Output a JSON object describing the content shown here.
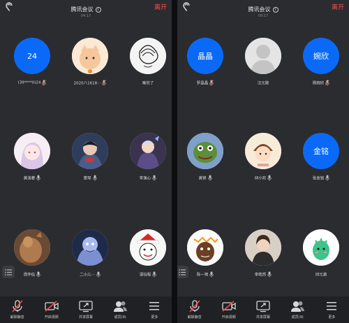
{
  "left": {
    "title": "腾讯会议",
    "subtitle": "04:17",
    "leave": "离开",
    "participants": [
      {
        "name": "(39****0)24",
        "avatar_text": "24",
        "type": "blue"
      },
      {
        "name": "2020八1618···",
        "type": "pic"
      },
      {
        "name": "喻世了",
        "type": "pic"
      },
      {
        "name": "黄洛菱",
        "type": "pic"
      },
      {
        "name": "曾琛",
        "type": "pic"
      },
      {
        "name": "李逸心",
        "type": "pic"
      },
      {
        "name": "周仲伍",
        "type": "pic"
      },
      {
        "name": "二小儿···",
        "type": "pic"
      },
      {
        "name": "谭钰程",
        "type": "pic"
      }
    ]
  },
  "right": {
    "title": "腾讯会议",
    "subtitle": "09:17",
    "leave": "离开",
    "participants": [
      {
        "name": "罗晶晶",
        "avatar_text": "晶晶",
        "type": "blue"
      },
      {
        "name": "汪元陵",
        "type": "pic"
      },
      {
        "name": "杨婉欣",
        "avatar_text": "婉欣",
        "type": "blue"
      },
      {
        "name": "黄锦",
        "type": "pic"
      },
      {
        "name": "邱小欢",
        "type": "pic"
      },
      {
        "name": "张金铭",
        "avatar_text": "金铭",
        "type": "blue"
      },
      {
        "name": "陈一锦",
        "type": "pic"
      },
      {
        "name": "李皓然",
        "type": "pic"
      },
      {
        "name": "邱元澈",
        "type": "pic"
      }
    ]
  },
  "toolbar": {
    "unmute": "解除静音",
    "video": "开启视频",
    "share": "共享屏幕",
    "members_left": "成员(9)",
    "members_right": "成员(9)",
    "more": "更多"
  },
  "colors": {
    "accent_blue": "#0a6af7",
    "leave_red": "#ff4b4b",
    "mic_muted": "#ff4b4b"
  }
}
